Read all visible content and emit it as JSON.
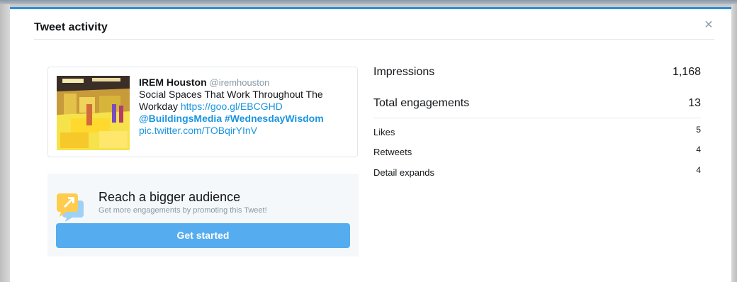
{
  "modal": {
    "title": "Tweet activity",
    "close_label": "×"
  },
  "tweet": {
    "author": "IREM Houston",
    "handle": "@iremhouston",
    "text_line1": "Social Spaces That Work Throughout The",
    "text_line2_prefix": "Workday ",
    "link": "https://goo.gl/EBCGHD",
    "mention": "@BuildingsMedia",
    "hashtag": "#WednesdayWisdom",
    "pic_link": "pic.twitter.com/TOBqirYInV"
  },
  "promo": {
    "title": "Reach a bigger audience",
    "subtitle": "Get more engagements by promoting this Tweet!",
    "button_label": "Get started"
  },
  "metrics": {
    "impressions": {
      "label": "Impressions",
      "value": "1,168"
    },
    "total_engagements": {
      "label": "Total engagements",
      "value": "13"
    },
    "breakdown": [
      {
        "label": "Likes",
        "value": "5"
      },
      {
        "label": "Retweets",
        "value": "4"
      },
      {
        "label": "Detail expands",
        "value": "4"
      }
    ]
  },
  "colors": {
    "accent": "#1b95e0",
    "button": "#55acee",
    "modal_top_border": "#2b8fd6"
  }
}
